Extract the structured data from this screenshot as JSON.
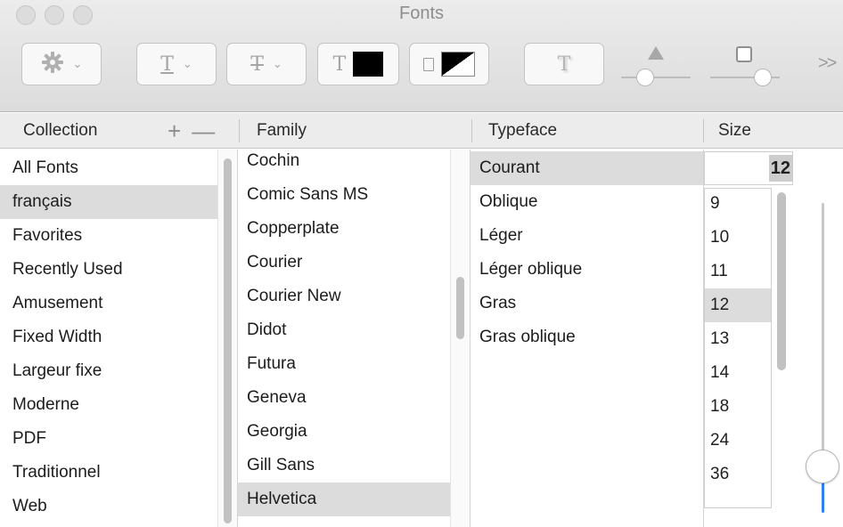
{
  "window": {
    "title": "Fonts"
  },
  "toolbar": {
    "text_underline_glyph": "T",
    "text_strike_glyph": "T",
    "text_color_glyph": "T",
    "shadow_glyph": "T",
    "overflow_label": ">>",
    "text_color": "#000000",
    "shadow_level": 0.35,
    "shadow_blur_level": 0.75
  },
  "columns": {
    "collection": "Collection",
    "family": "Family",
    "typeface": "Typeface",
    "size": "Size",
    "add_label": "+",
    "remove_label": "—"
  },
  "collections": {
    "selected_index": 1,
    "items": [
      "All Fonts",
      "français",
      "Favorites",
      "Recently Used",
      "Amusement",
      "Fixed Width",
      "Largeur fixe",
      "Moderne",
      "PDF",
      "Traditionnel",
      "Web"
    ]
  },
  "families": {
    "selected_index": 10,
    "items": [
      "Cochin",
      "Comic Sans MS",
      "Copperplate",
      "Courier",
      "Courier New",
      "Didot",
      "Futura",
      "Geneva",
      "Georgia",
      "Gill Sans",
      "Helvetica"
    ]
  },
  "typefaces": {
    "selected_index": 0,
    "items": [
      "Courant",
      "Oblique",
      "Léger",
      "Léger oblique",
      "Gras",
      "Gras oblique"
    ]
  },
  "size": {
    "value": "12",
    "selected_index": 3,
    "items": [
      "9",
      "10",
      "11",
      "12",
      "13",
      "14",
      "18",
      "24",
      "36"
    ],
    "slider_level": 0.15
  }
}
